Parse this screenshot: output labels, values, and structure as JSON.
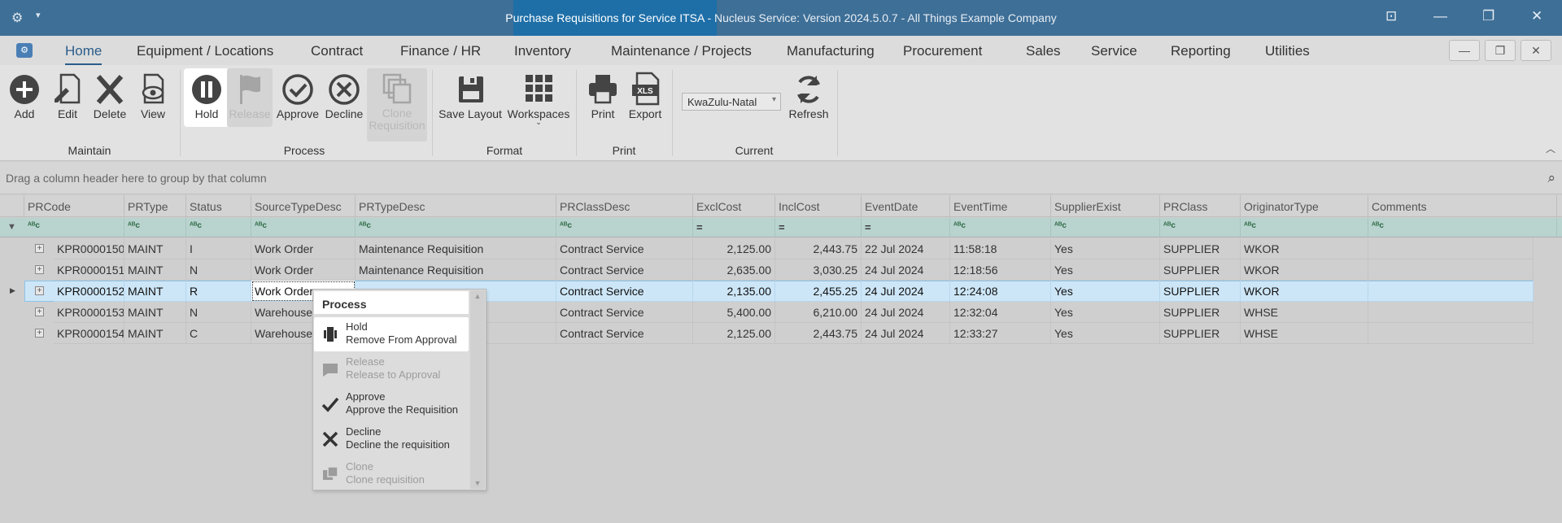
{
  "titlebar": {
    "title_main": "Purchase Requisitions for Service ITSA - ",
    "title_rest": "Nucleus Service: Version 2024.5.0.7 - All Things Example Company",
    "app_icon": "gear-icon",
    "app_dropdown": "▾",
    "restore_layout": "⊡",
    "minimize": "—",
    "maximize": "❐",
    "close": "✕"
  },
  "tabs": [
    "Home",
    "Equipment / Locations",
    "Contract",
    "Finance / HR",
    "Inventory",
    "Maintenance / Projects",
    "Manufacturing",
    "Procurement",
    "Sales",
    "Service",
    "Reporting",
    "Utilities"
  ],
  "mdi": {
    "minimize": "—",
    "restore": "❐",
    "close": "✕"
  },
  "ribbon": {
    "maintain": {
      "label": "Maintain",
      "add": "Add",
      "edit": "Edit",
      "delete": "Delete",
      "view": "View"
    },
    "process": {
      "label": "Process",
      "hold": "Hold",
      "release": "Release",
      "approve": "Approve",
      "decline": "Decline",
      "clone_1": "Clone",
      "clone_2": "Requisition"
    },
    "format": {
      "label": "Format",
      "save_layout": "Save Layout",
      "workspaces": "Workspaces"
    },
    "print": {
      "label": "Print",
      "print": "Print",
      "export": "Export"
    },
    "current": {
      "label": "Current",
      "region": "KwaZulu-Natal"
    },
    "refresh": "Refresh"
  },
  "group_panel": {
    "hint": "Drag a column header here to group by that column"
  },
  "grid": {
    "columns": [
      "PRCode",
      "PRType",
      "Status",
      "SourceTypeDesc",
      "PRTypeDesc",
      "PRClassDesc",
      "ExclCost",
      "InclCost",
      "EventDate",
      "EventTime",
      "SupplierExist",
      "PRClass",
      "OriginatorType",
      "Comments"
    ],
    "filter_text": "ᴬᴮc",
    "filter_eq": "=",
    "rows": [
      {
        "PRCode": "KPR0000150",
        "PRType": "MAINT",
        "Status": "I",
        "SourceTypeDesc": "Work Order",
        "PRTypeDesc": "Maintenance Requisition",
        "PRClassDesc": "Contract Service",
        "ExclCost": "2,125.00",
        "InclCost": "2,443.75",
        "EventDate": "22 Jul 2024",
        "EventTime": "11:58:18",
        "SupplierExist": "Yes",
        "PRClass": "SUPPLIER",
        "OriginatorType": "WKOR",
        "Comments": ""
      },
      {
        "PRCode": "KPR0000151",
        "PRType": "MAINT",
        "Status": "N",
        "SourceTypeDesc": "Work Order",
        "PRTypeDesc": "Maintenance Requisition",
        "PRClassDesc": "Contract Service",
        "ExclCost": "2,635.00",
        "InclCost": "3,030.25",
        "EventDate": "24 Jul 2024",
        "EventTime": "12:18:56",
        "SupplierExist": "Yes",
        "PRClass": "SUPPLIER",
        "OriginatorType": "WKOR",
        "Comments": ""
      },
      {
        "PRCode": "KPR0000152",
        "PRType": "MAINT",
        "Status": "R",
        "SourceTypeDesc": "Work Order",
        "PRTypeDesc": "",
        "PRClassDesc": "Contract Service",
        "ExclCost": "2,135.00",
        "InclCost": "2,455.25",
        "EventDate": "24 Jul 2024",
        "EventTime": "12:24:08",
        "SupplierExist": "Yes",
        "PRClass": "SUPPLIER",
        "OriginatorType": "WKOR",
        "Comments": ""
      },
      {
        "PRCode": "KPR0000153",
        "PRType": "MAINT",
        "Status": "N",
        "SourceTypeDesc": "Warehouse",
        "PRTypeDesc": "",
        "PRClassDesc": "Contract Service",
        "ExclCost": "5,400.00",
        "InclCost": "6,210.00",
        "EventDate": "24 Jul 2024",
        "EventTime": "12:32:04",
        "SupplierExist": "Yes",
        "PRClass": "SUPPLIER",
        "OriginatorType": "WHSE",
        "Comments": ""
      },
      {
        "PRCode": "KPR0000154",
        "PRType": "MAINT",
        "Status": "C",
        "SourceTypeDesc": "Warehouse",
        "PRTypeDesc": "",
        "PRClassDesc": "Contract Service",
        "ExclCost": "2,125.00",
        "InclCost": "2,443.75",
        "EventDate": "24 Jul 2024",
        "EventTime": "12:33:27",
        "SupplierExist": "Yes",
        "PRClass": "SUPPLIER",
        "OriginatorType": "WHSE",
        "Comments": ""
      }
    ]
  },
  "context_menu": {
    "title": "Process",
    "items": [
      {
        "title": "Hold",
        "desc": "Remove From Approval",
        "icon": "pause-icon"
      },
      {
        "title": "Release",
        "desc": "Release to Approval",
        "icon": "flag-icon"
      },
      {
        "title": "Approve",
        "desc": "Approve the Requisition",
        "icon": "check-icon"
      },
      {
        "title": "Decline",
        "desc": "Decline the requisition",
        "icon": "x-icon"
      },
      {
        "title": "Clone",
        "desc": "Clone requisition",
        "icon": "clone-icon"
      }
    ]
  }
}
